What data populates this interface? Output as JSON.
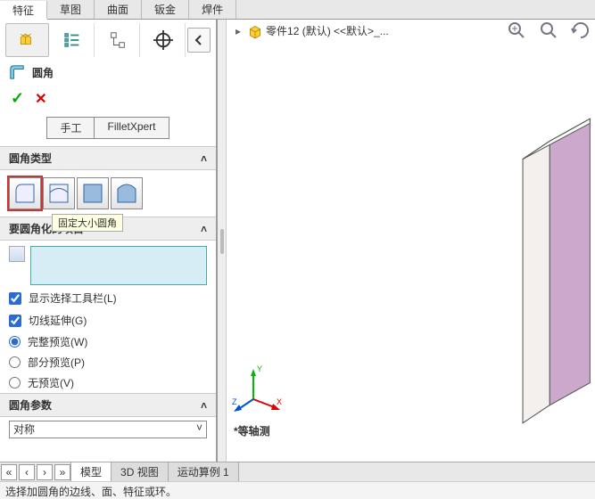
{
  "topTabs": {
    "items": [
      "特征",
      "草图",
      "曲面",
      "钣金",
      "焊件"
    ],
    "active": 0
  },
  "panel": {
    "title": "圆角",
    "modes": {
      "manual": "手工",
      "expert": "FilletXpert"
    },
    "sectionType": "圆角类型",
    "tooltip": "固定大小圆角",
    "sectionItems": "要圆角化的项目",
    "chkShowToolbar": "显示选择工具栏(L)",
    "chkTangent": "切线延伸(G)",
    "rFull": "完整预览(W)",
    "rPartial": "部分预览(P)",
    "rNone": "无预览(V)",
    "sectionParams": "圆角参数",
    "symmetric": "对称"
  },
  "breadcrumb": {
    "part": "零件12 (默认) <<默认>_..."
  },
  "viewport": {
    "isoLabel": "*等轴测"
  },
  "bottomTabs": {
    "items": [
      "模型",
      "3D 视图",
      "运动算例 1"
    ],
    "active": 0
  },
  "status": "选择加圆角的边线、面、特征或环。"
}
